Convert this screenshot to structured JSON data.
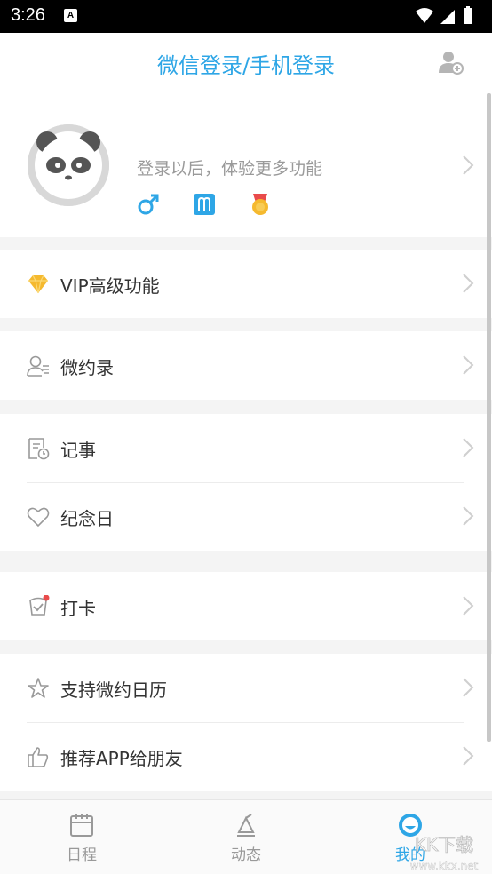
{
  "status_bar": {
    "time": "3:26",
    "notification_icon": "A"
  },
  "header": {
    "title": "微信登录/手机登录",
    "action_icon": "add-user-icon"
  },
  "profile": {
    "hint": "登录以后，体验更多功能",
    "badges": [
      "male-icon",
      "zodiac-icon",
      "medal-icon"
    ]
  },
  "menu": {
    "vip": "VIP高级功能",
    "contacts": "微约录",
    "notes": "记事",
    "anniversary": "纪念日",
    "checkin": "打卡",
    "support": "支持微约日历",
    "recommend": "推荐APP给朋友"
  },
  "tabs": [
    {
      "label": "日程",
      "icon": "calendar-icon"
    },
    {
      "label": "动态",
      "icon": "feed-icon"
    },
    {
      "label": "我的",
      "icon": "smile-icon"
    }
  ],
  "watermark": {
    "text1": "KK下载",
    "text2": "www.kkx.net"
  },
  "colors": {
    "accent": "#2ea6e6",
    "background": "#f4f4f4",
    "text": "#333333"
  }
}
